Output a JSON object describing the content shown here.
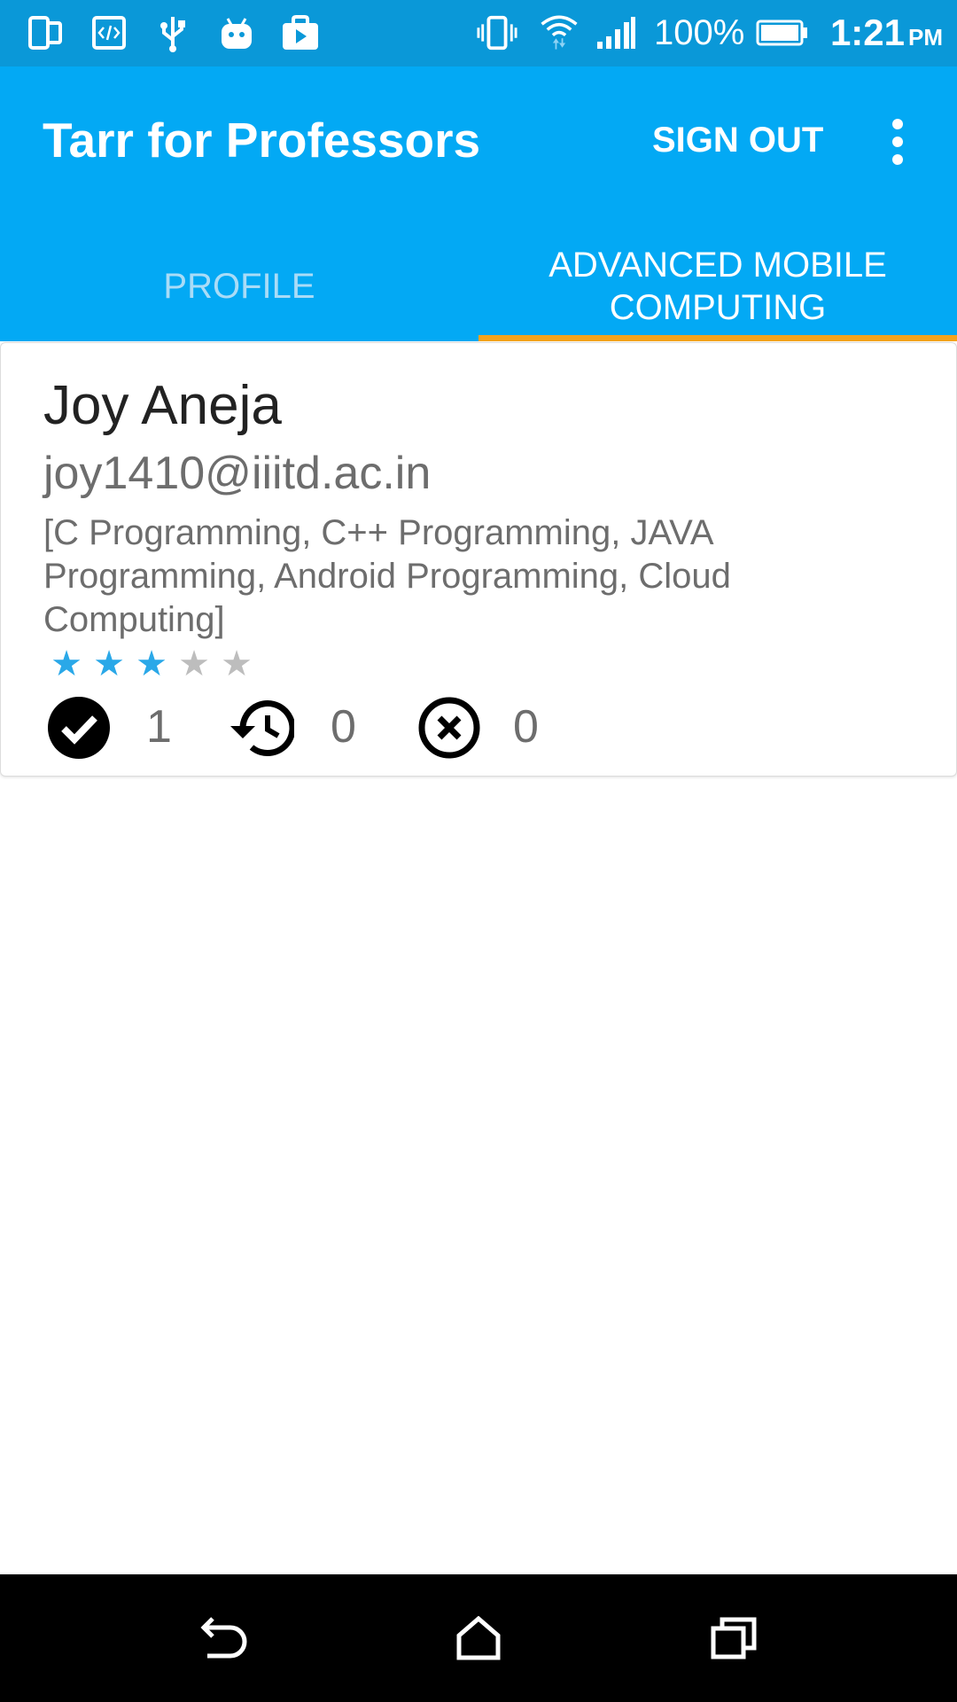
{
  "status_bar": {
    "battery_percent": "100%",
    "time": "1:21",
    "time_suffix": "PM",
    "icons": [
      "dual-screen-icon",
      "developer-code-icon",
      "usb-icon",
      "android-icon",
      "play-store-icon",
      "vibrate-icon",
      "wifi-icon",
      "signal-icon",
      "battery-icon"
    ]
  },
  "app_bar": {
    "title": "Tarr for Professors",
    "sign_out_label": "SIGN OUT",
    "overflow_icon": "more-vert-icon"
  },
  "tabs": [
    {
      "label": "PROFILE",
      "selected": false
    },
    {
      "label": "ADVANCED MOBILE COMPUTING",
      "selected": true
    }
  ],
  "colors": {
    "status_bar": "#0a98d8",
    "app_bar": "#03a9f4",
    "tab_indicator": "#f4a31c",
    "star_on": "#2aa8e8",
    "star_off": "#bdbdbd"
  },
  "student": {
    "name": "Joy Aneja",
    "email": "joy1410@iiitd.ac.in",
    "skills": "[C Programming, C++ Programming, JAVA Programming, Android Programming, Cloud Computing]",
    "rating": 3,
    "rating_max": 5,
    "approved_count": "1",
    "pending_count": "0",
    "rejected_count": "0"
  },
  "nav_bar": {
    "icons": [
      "back-icon",
      "home-icon",
      "recents-icon"
    ]
  }
}
